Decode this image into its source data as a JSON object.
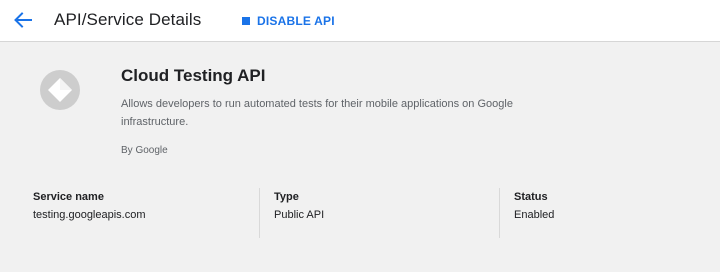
{
  "header": {
    "back_icon": "arrow-back-icon",
    "title": "API/Service Details",
    "disable_label": "DISABLE API",
    "disable_icon": "stop-square-icon",
    "accent_color": "#1a73e8"
  },
  "api": {
    "logo_icon": "cloud-testing-diamond-icon",
    "name": "Cloud Testing API",
    "description": "Allows developers to run automated tests for their mobile applications on Google infrastructure.",
    "vendor": "By Google"
  },
  "details": [
    {
      "label": "Service name",
      "value": "testing.googleapis.com"
    },
    {
      "label": "Type",
      "value": "Public API"
    },
    {
      "label": "Status",
      "value": "Enabled"
    }
  ]
}
